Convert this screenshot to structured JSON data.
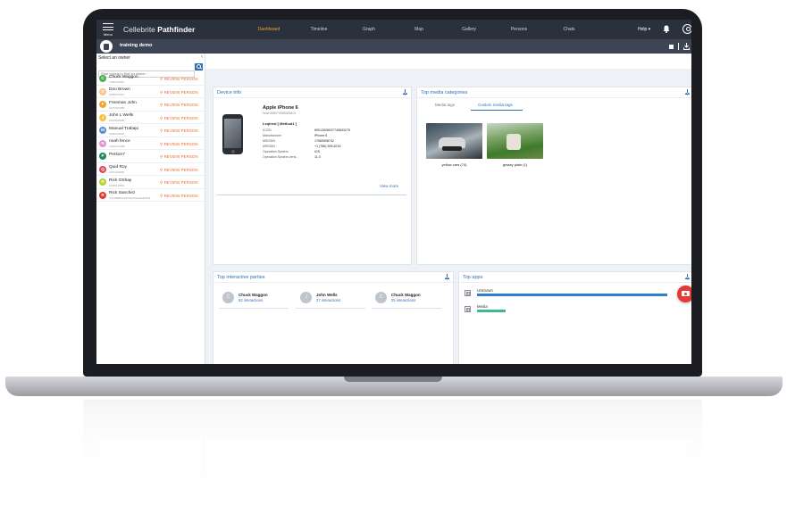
{
  "nav": {
    "menu_label": "Menu",
    "brand_prefix": "Cellebrite",
    "brand_name": "Pathfinder",
    "tabs": [
      "Dashboard",
      "Timeline",
      "Graph",
      "Map",
      "Gallery",
      "Persons",
      "Chats"
    ],
    "active_tab": "Dashboard",
    "help_label": "Help ▾"
  },
  "case": {
    "name": "training demo"
  },
  "owners": {
    "title": "Select an owner",
    "collapse_glyph": "‹",
    "search_placeholder": "Start typing to find an owner...",
    "review_label": "REVIEW PERSON",
    "review_glyph": "⚲",
    "items": [
      {
        "name": "Chuck Waggon",
        "sub": "17863234562",
        "initial": "C",
        "color": "#4caf50"
      },
      {
        "name": "Doo Brown",
        "sub": "18058571027",
        "initial": "D",
        "color": "#f7c68a"
      },
      {
        "name": "Freeman John",
        "sub": "19372337985",
        "initial": "F",
        "color": "#f0a830"
      },
      {
        "name": "John L Wells",
        "sub": "16016930986",
        "initial": "J",
        "color": "#f6c342"
      },
      {
        "name": "Manual Trabajo",
        "sub": "16092134636",
        "initial": "M",
        "color": "#5b8fd6"
      },
      {
        "name": "noah fence",
        "sub": "noahfence999",
        "initial": "N",
        "color": "#e98fd8"
      },
      {
        "name": "Person7",
        "sub": "",
        "initial": "P",
        "color": "#1f8a5f"
      },
      {
        "name": "Quid Roy",
        "sub": "14072102082",
        "initial": "Q",
        "color": "#e04a5a"
      },
      {
        "name": "Rick OShay",
        "sub": "15055310691",
        "initial": "R",
        "color": "#b3d334"
      },
      {
        "name": "Rick Sanchez",
        "sub": "rick7d3880eed4d1ded70ea9d4bb0d9",
        "initial": "R",
        "color": "#e53935"
      }
    ]
  },
  "device_info": {
    "title": "Device info",
    "device_name": "Apple iPhone 6",
    "device_sub": "Host 358070065083401",
    "extraction": "Leqirest [ Method1 ]",
    "fields": [
      {
        "k": "ICCID",
        "v": "89012608037745833275"
      },
      {
        "k": "Manufacturer",
        "v": "iPhone 6"
      },
      {
        "k": "MSISDN",
        "v": "17865998742"
      },
      {
        "k": "MSISDN",
        "v": "+1 (786) 599-8742"
      },
      {
        "k": "Operation System",
        "v": "iOS"
      },
      {
        "k": "Operation System versi...",
        "v": "11.0"
      }
    ],
    "view_more": "View more"
  },
  "top_media": {
    "title": "Top media categories",
    "tabs": [
      "Media tags",
      "Custom media tags"
    ],
    "active_tab": "Custom media tags",
    "items": [
      {
        "caption": "yellow cars (74)"
      },
      {
        "caption": "grassy plain (1)"
      }
    ]
  },
  "top_parties": {
    "title": "Top interactive parties",
    "items": [
      {
        "initial": "C",
        "name": "Chuck Waggon",
        "interactions": "62 interactions"
      },
      {
        "initial": "J",
        "name": "John Wells",
        "interactions": "27 interactions"
      },
      {
        "initial": "C",
        "name": "Chuck Waggon",
        "interactions": "25 interactions"
      }
    ]
  },
  "top_apps": {
    "title": "Top apps",
    "items": [
      {
        "name": "Unknown",
        "share": 1.0,
        "color": "#2f7fd1"
      },
      {
        "name": "Media",
        "share": 0.15,
        "color": "#3dbb8a"
      }
    ]
  },
  "colors": {
    "accent": "#2f6fb5",
    "active_tab": "#f5a623",
    "review": "#ef6b2c",
    "fab": "#e53935"
  }
}
